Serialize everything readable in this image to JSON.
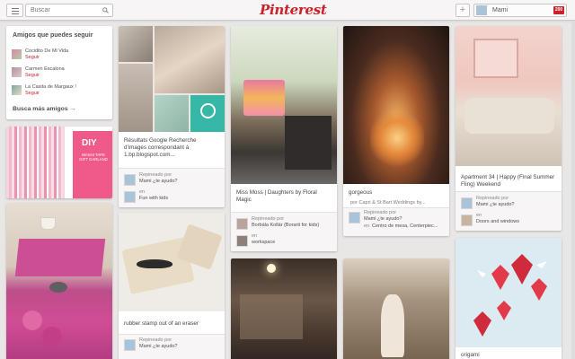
{
  "header": {
    "search_placeholder": "Buscar",
    "logo": "Pinterest",
    "add_label": "+",
    "user_name": "Mami",
    "notification_count": "200"
  },
  "friends": {
    "title": "Amigos que puedes seguir",
    "items": [
      {
        "name": "Cocidito De Mi Vida",
        "action": "Seguir"
      },
      {
        "name": "Carmen Escalona",
        "action": "Seguir"
      },
      {
        "name": "La Casita de Margaux !",
        "action": "Seguir"
      }
    ],
    "more_label": "Busca más amigos →"
  },
  "pins": [
    {
      "description": "Résultats Google Recherche d'images correspondant à 1.bp.blogspot.com...",
      "by": "Repineado por",
      "user": "Mami ¿te ayudo?",
      "on": "en",
      "board": "Fun with kids"
    },
    {
      "description": "rubber stamp out of an eraser",
      "by": "Repineado por",
      "user": "Mami ¿te ayudo?"
    },
    {
      "description": "Miss Moss | Daughters by Floral Magic",
      "by": "Repineado por",
      "user": "Borbála Kollár (Borarti for kids)",
      "on": "en",
      "board": "workspace"
    },
    {
      "description": "gorgeous",
      "by": "Repineado por",
      "user": "por Capri & St Bart Weddings by...",
      "user2": "Mami ¿te ayudo?",
      "on": "en",
      "board": "Centro de mesa, Centerpiec..."
    },
    {
      "description": "Apartment 34 | Happy (Final Summer Fling) Weekend",
      "by": "Repineado por",
      "user": "Mami ¿te ayudo?",
      "on": "en",
      "board": "Doors and windows"
    },
    {
      "description": "origami"
    }
  ],
  "diy_text": "DIY",
  "diy_sub": "WASHI TAPE GIFT GARLAND",
  "colors": {
    "brand": "#c8232c",
    "background": "#e9e6e6"
  }
}
